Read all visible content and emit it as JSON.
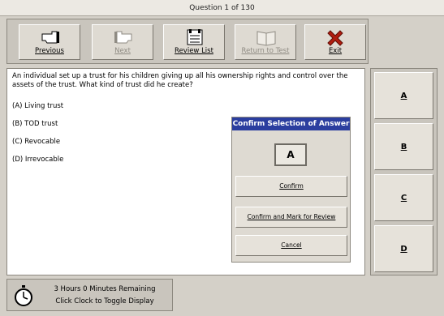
{
  "window": {
    "title": "Question 1 of 130"
  },
  "toolbar": {
    "buttons": [
      {
        "label": "Previous",
        "icon": "hand-pointing-left-icon",
        "enabled": true
      },
      {
        "label": "Next",
        "icon": "hand-pointing-right-icon",
        "enabled": false
      },
      {
        "label": "Review List",
        "icon": "review-list-icon",
        "enabled": true
      },
      {
        "label": "Return to Test",
        "icon": "open-book-icon",
        "enabled": false
      },
      {
        "label": "Exit",
        "icon": "exit-x-icon",
        "enabled": true
      }
    ]
  },
  "question": {
    "text": "An individual set up a trust for his children giving up all his ownership rights and control over the assets of the trust. What kind of trust did he create?",
    "options": [
      "(A) Living trust",
      "(B) TOD trust",
      "(C) Revocable",
      "(D) Irrevocable"
    ]
  },
  "dialog": {
    "title": "Confirm Selection of Answer",
    "selected": "A",
    "buttons": [
      "Confirm",
      "Confirm and Mark for Review",
      "Cancel"
    ]
  },
  "answers": [
    "A",
    "B",
    "C",
    "D"
  ],
  "clock": {
    "line1": "3 Hours 0 Minutes Remaining",
    "line2": "Click Clock to Toggle Display"
  },
  "colors": {
    "dialog_title_bg": "#2b3e9f",
    "exit_icon": "#b01d10",
    "chrome": "#d4d0c8"
  }
}
